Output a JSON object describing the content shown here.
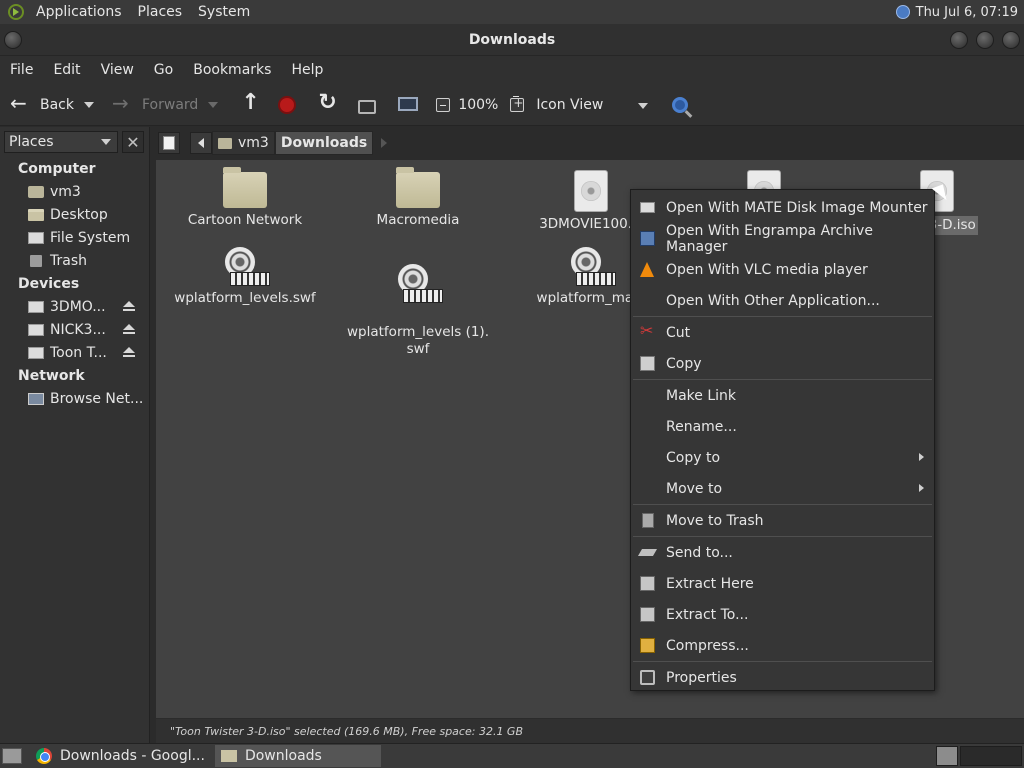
{
  "top_panel": {
    "menus": [
      "Applications",
      "Places",
      "System"
    ],
    "clock": "Thu Jul  6, 07:19"
  },
  "window": {
    "title": "Downloads"
  },
  "menubar": [
    "File",
    "Edit",
    "View",
    "Go",
    "Bookmarks",
    "Help"
  ],
  "toolbar": {
    "back_label": "Back",
    "forward_label": "Forward",
    "zoom_level": "100%",
    "view_mode": "Icon View"
  },
  "sidebar": {
    "selector_label": "Places",
    "sections": [
      {
        "title": "Computer",
        "items": [
          {
            "label": "vm3",
            "icon": "home"
          },
          {
            "label": "Desktop",
            "icon": "folder"
          },
          {
            "label": "File System",
            "icon": "drive"
          },
          {
            "label": "Trash",
            "icon": "trash"
          }
        ]
      },
      {
        "title": "Devices",
        "items": [
          {
            "label": "3DMO...",
            "icon": "drive"
          },
          {
            "label": "NICK3...",
            "icon": "drive"
          },
          {
            "label": "Toon T...",
            "icon": "drive"
          }
        ]
      },
      {
        "title": "Network",
        "items": [
          {
            "label": "Browse Net...",
            "icon": "net"
          }
        ]
      }
    ]
  },
  "pathbar": {
    "crumbs": [
      "vm3",
      "Downloads"
    ]
  },
  "files": [
    {
      "name": "Cartoon Network",
      "icon": "folder"
    },
    {
      "name": "Macromedia",
      "icon": "folder"
    },
    {
      "name": "3DMOVIE100.is",
      "icon": "disc"
    },
    {
      "name": "",
      "icon": "disc"
    },
    {
      "name": "ster 3-D.iso",
      "icon": "disc"
    },
    {
      "name": "wplatform_levels.swf",
      "icon": "film"
    },
    {
      "name": "wplatform_levels (1).\nswf",
      "icon": "film"
    },
    {
      "name": "wplatform_main",
      "icon": "film"
    }
  ],
  "context_menu": {
    "items": [
      {
        "label": "Open With MATE Disk Image Mounter",
        "icon": "disk-icon"
      },
      {
        "label": "Open With Engrampa Archive Manager",
        "icon": "archive-icon"
      },
      {
        "label": "Open With VLC media player",
        "icon": "vlc-icon"
      },
      {
        "label": "Open With Other Application...",
        "icon": ""
      },
      {
        "label": "Cut",
        "icon": "cut-icon"
      },
      {
        "label": "Copy",
        "icon": "copy-icon"
      },
      {
        "label": "Make Link",
        "icon": ""
      },
      {
        "label": "Rename...",
        "icon": ""
      },
      {
        "label": "Copy to",
        "icon": ""
      },
      {
        "label": "Move to",
        "icon": ""
      },
      {
        "label": "Move to Trash",
        "icon": "trash-icon"
      },
      {
        "label": "Send to...",
        "icon": "send-icon"
      },
      {
        "label": "Extract Here",
        "icon": "extract-icon"
      },
      {
        "label": "Extract To...",
        "icon": "extract-icon"
      },
      {
        "label": "Compress...",
        "icon": "compress-icon"
      },
      {
        "label": "Properties",
        "icon": "properties-icon"
      }
    ]
  },
  "statusbar": {
    "text": "\"Toon Twister 3-D.iso\" selected (169.6 MB), Free space: 32.1 GB"
  },
  "taskbar": {
    "tasks": [
      "Downloads - Googl...",
      "Downloads"
    ]
  }
}
